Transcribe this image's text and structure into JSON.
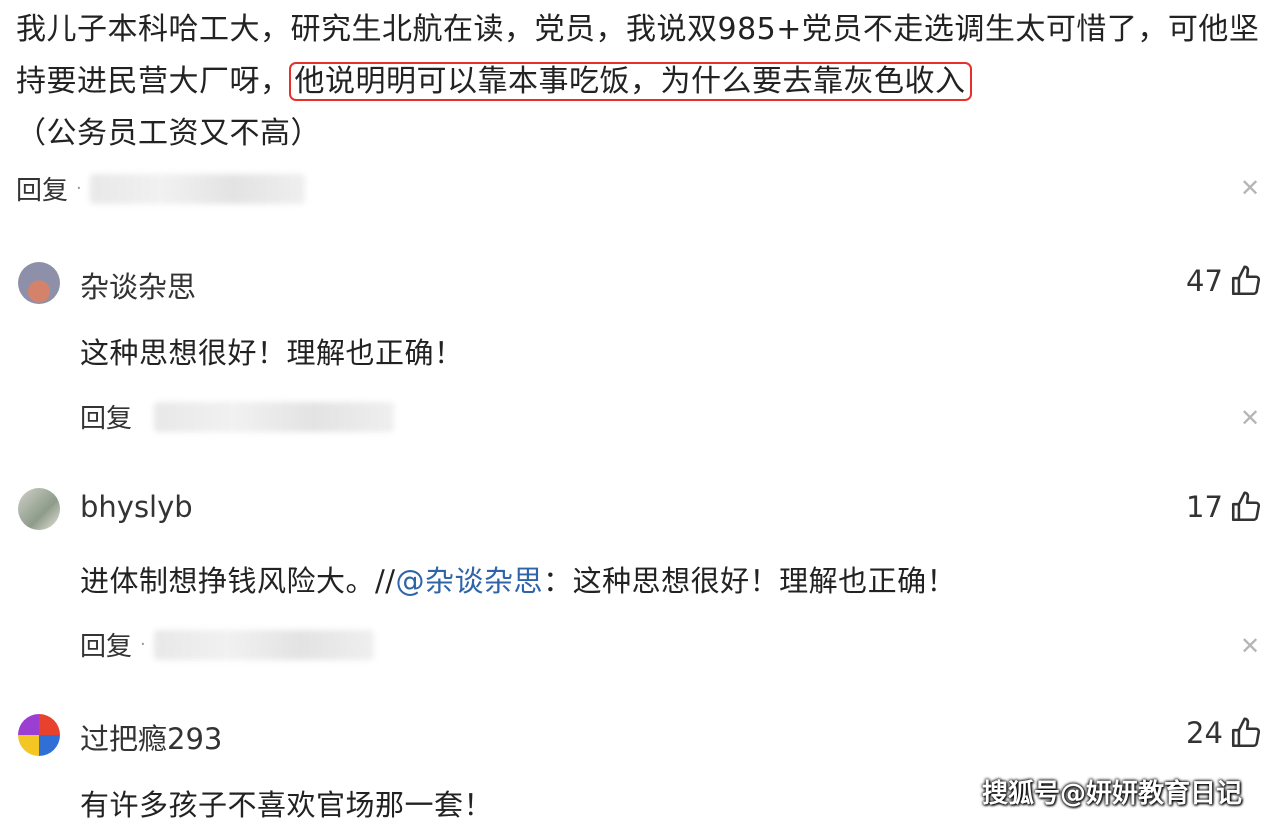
{
  "root": {
    "text_before": "我儿子本科哈工大，研究生北航在读，党员，我说双985+党员不走选调生太可惜了，可他坚持要进民营大厂呀，",
    "highlight": "他说明明可以靠本事吃饭，为什么要去靠灰色收入",
    "text_after": "（公务员工资又不高）",
    "reply_label": "回复"
  },
  "comments": [
    {
      "name": "杂谈杂思",
      "likes": "47",
      "text": "这种思想很好！理解也正确！",
      "reply_label": "回复"
    },
    {
      "name": "bhyslyb",
      "likes": "17",
      "text": "进体制想挣钱风险大。//",
      "mention": "@杂谈杂思",
      "quote": "：这种思想很好！理解也正确！",
      "reply_label": "回复"
    },
    {
      "name": "过把瘾293",
      "likes": "24",
      "text": "有许多孩子不喜欢官场那一套！"
    }
  ],
  "icons": {
    "close": "close-icon",
    "like": "thumbs-up-icon"
  },
  "colors": {
    "highlight_border": "#e8302b",
    "mention": "#2f64a8"
  },
  "watermark": "搜狐号@妍妍教育日记"
}
